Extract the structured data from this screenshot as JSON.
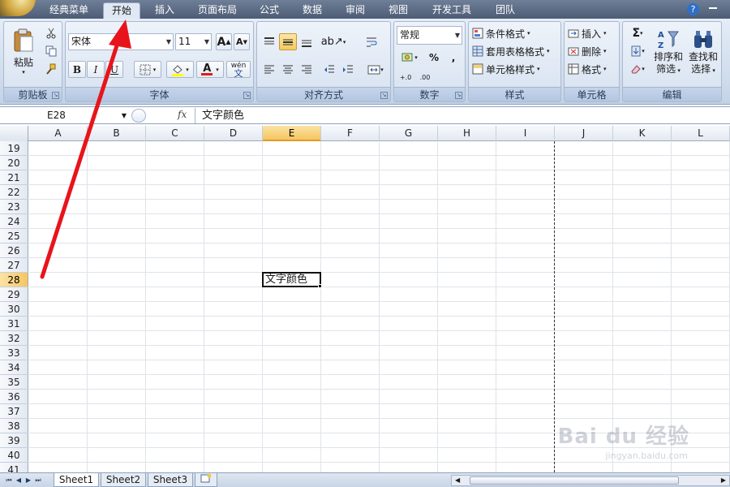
{
  "menu_tabs": [
    "经典菜单",
    "开始",
    "插入",
    "页面布局",
    "公式",
    "数据",
    "审阅",
    "视图",
    "开发工具",
    "团队"
  ],
  "active_tab": "开始",
  "ribbon": {
    "clipboard": {
      "label": "剪贴板",
      "paste": "粘贴"
    },
    "font": {
      "label": "字体",
      "font_name": "宋体",
      "font_size": "11",
      "bold": "B",
      "italic": "I",
      "underline": "U",
      "grow": "A",
      "shrink": "A",
      "font_color": "A",
      "phonetic": "wén"
    },
    "alignment": {
      "label": "对齐方式"
    },
    "number": {
      "label": "数字",
      "format": "常规",
      "percent": "%",
      "comma": ",",
      "inc_decimal": "+.0",
      "dec_decimal": ".00"
    },
    "styles": {
      "label": "样式",
      "conditional": "条件格式",
      "table": "套用表格格式",
      "cell_styles": "单元格样式"
    },
    "cells": {
      "label": "单元格",
      "insert": "插入",
      "delete": "删除",
      "format": "格式"
    },
    "editing": {
      "label": "编辑",
      "sum": "Σ",
      "sort_filter_1": "排序和",
      "sort_filter_2": "筛选",
      "find_select_1": "查找和",
      "find_select_2": "选择"
    }
  },
  "formula_bar": {
    "name_box": "E28",
    "fx": "fx",
    "content": "文字颜色"
  },
  "columns": [
    "A",
    "B",
    "C",
    "D",
    "E",
    "F",
    "G",
    "H",
    "I",
    "J",
    "K",
    "L"
  ],
  "rows": [
    "19",
    "20",
    "21",
    "22",
    "23",
    "24",
    "25",
    "26",
    "27",
    "28",
    "29",
    "30",
    "31",
    "32",
    "33",
    "34",
    "35",
    "36",
    "37",
    "38",
    "39",
    "40",
    "41"
  ],
  "selected_column": "E",
  "selected_row": "28",
  "active_cell": {
    "ref": "E28",
    "value": "文字颜色"
  },
  "sheets": [
    "Sheet1",
    "Sheet2",
    "Sheet3"
  ],
  "active_sheet": "Sheet1",
  "watermark": {
    "main": "Bai du 经验",
    "sub": "jingyan.baidu.com"
  },
  "colors": {
    "annotation_arrow": "#e8141b",
    "selection": "#f6c561",
    "ribbon": "#d6e2f0"
  }
}
